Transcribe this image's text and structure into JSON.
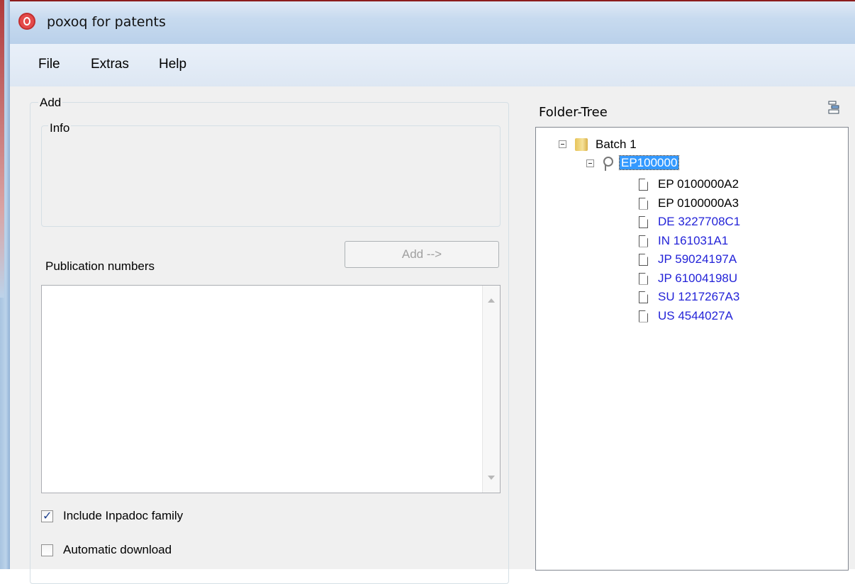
{
  "window": {
    "title": "poxoq for patents"
  },
  "menu": [
    "File",
    "Extras",
    "Help"
  ],
  "add_panel": {
    "group_label": "Add",
    "info_label": "Info",
    "add_button_label": "Add -->",
    "publication_numbers_label": "Publication numbers",
    "publication_numbers_value": "",
    "include_inpadoc_label": "Include Inpadoc family",
    "include_inpadoc_checked": true,
    "automatic_download_label": "Automatic download",
    "automatic_download_checked": false
  },
  "folder_tree": {
    "label": "Folder-Tree",
    "batch_label": "Batch 1",
    "patent_label": "EP100000",
    "documents": [
      {
        "label": "EP 0100000A2",
        "color": "#000000"
      },
      {
        "label": "EP 0100000A3",
        "color": "#000000"
      },
      {
        "label": "DE 3227708C1",
        "color": "#2323d8"
      },
      {
        "label": "IN 161031A1",
        "color": "#2323d8"
      },
      {
        "label": "JP 59024197A",
        "color": "#2323d8"
      },
      {
        "label": "JP 61004198U",
        "color": "#2323d8"
      },
      {
        "label": "SU 1217267A3",
        "color": "#2323d8"
      },
      {
        "label": "US 4544027A",
        "color": "#2323d8"
      }
    ]
  }
}
